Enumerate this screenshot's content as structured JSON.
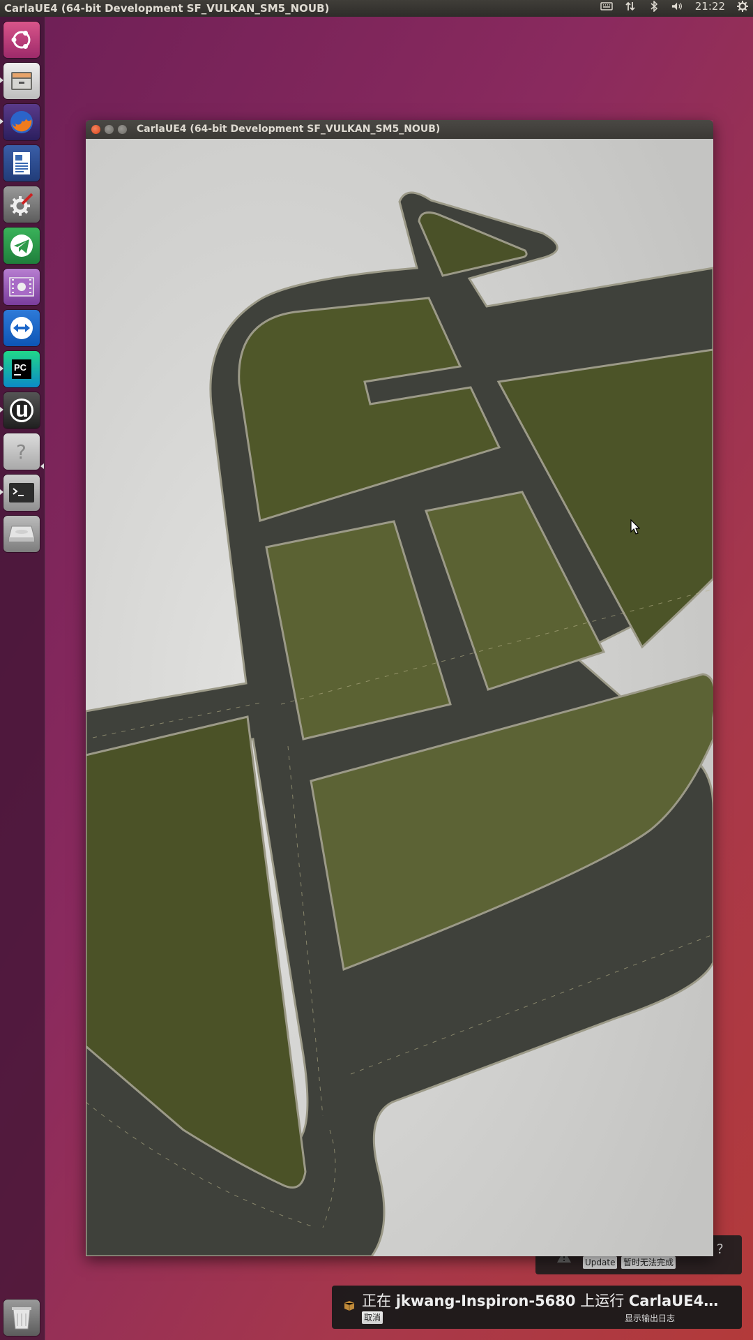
{
  "top_panel": {
    "title": "CarlaUE4 (64-bit Development SF_VULKAN_SM5_NOUB)",
    "time": "21:22",
    "tray_icons": [
      "keyboard-icon",
      "network-icon",
      "bluetooth-icon",
      "volume-icon",
      "gear-icon"
    ]
  },
  "launcher": {
    "items": [
      {
        "name": "ubuntu-dash-icon"
      },
      {
        "name": "files-icon"
      },
      {
        "name": "firefox-icon"
      },
      {
        "name": "writer-icon"
      },
      {
        "name": "system-settings-icon"
      },
      {
        "name": "telegram-icon"
      },
      {
        "name": "video-icon"
      },
      {
        "name": "teamviewer-icon"
      },
      {
        "name": "pycharm-icon"
      },
      {
        "name": "unreal-engine-icon"
      },
      {
        "name": "unknown-app-icon"
      },
      {
        "name": "terminal-icon"
      },
      {
        "name": "drive-icon"
      },
      {
        "name": "trash-icon"
      }
    ]
  },
  "window": {
    "title": "CarlaUE4 (64-bit Development SF_VULKAN_SM5_NOUB)"
  },
  "update_notification": {
    "partial_text": "？",
    "update_label": "Update",
    "later_label": "暂时无法完成"
  },
  "running_notification": {
    "prefix": "正在 ",
    "host": "jkwang-Inspiron-5680",
    "middle": " 上运行 ",
    "app": "CarlaUE4…",
    "cancel_label": "取消",
    "show_log_label": "显示输出日志"
  },
  "colors": {
    "road": "#3f413b",
    "grass": "#56602f",
    "curb": "#9c9a88",
    "ground": "#cfcfcd"
  }
}
